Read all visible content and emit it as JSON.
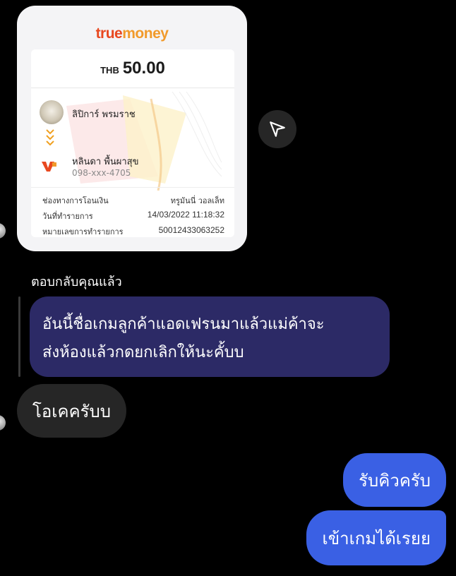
{
  "receipt": {
    "brand_part1": "true",
    "brand_part2": "money",
    "currency": "THB",
    "amount": "50.00",
    "sender_name": "ลิปิการ์ พรมราช",
    "receiver_name": "หลินดา พื้นผาสุข",
    "receiver_phone": "098-xxx-4705",
    "details": [
      {
        "label": "ช่องทางการโอนเงิน",
        "value": "ทรูมันนี่ วอลเล็ท"
      },
      {
        "label": "วันที่ทำรายการ",
        "value": "14/03/2022 11:18:32"
      },
      {
        "label": "หมายเลขการทำรายการ",
        "value": "50012433063252"
      }
    ]
  },
  "reply": {
    "label": "ตอบกลับคุณแล้ว",
    "quoted_line1": "อันนี้ชื่อเกมลูกค้าแอดเฟรนมาแล้วแม่ค้าจะ",
    "quoted_line2": "ส่งห้องแล้วกดยกเลิกให้นะคั้บบ"
  },
  "messages": {
    "incoming": "โอเคครับบ",
    "outgoing": [
      "รับคิวครับ",
      "เข้าเกมได้เรยย"
    ]
  },
  "colors": {
    "background": "#000000",
    "quoted_bubble": "#2c2a66",
    "incoming_bubble": "#262626",
    "outgoing_bubble": "#3a60e4",
    "brand_red": "#e8481f",
    "brand_orange": "#f19a2b"
  },
  "icons": {
    "share": "send-icon",
    "chevrons": "chevron-down-double-icon",
    "wallet": "truemoney-wallet-icon"
  }
}
